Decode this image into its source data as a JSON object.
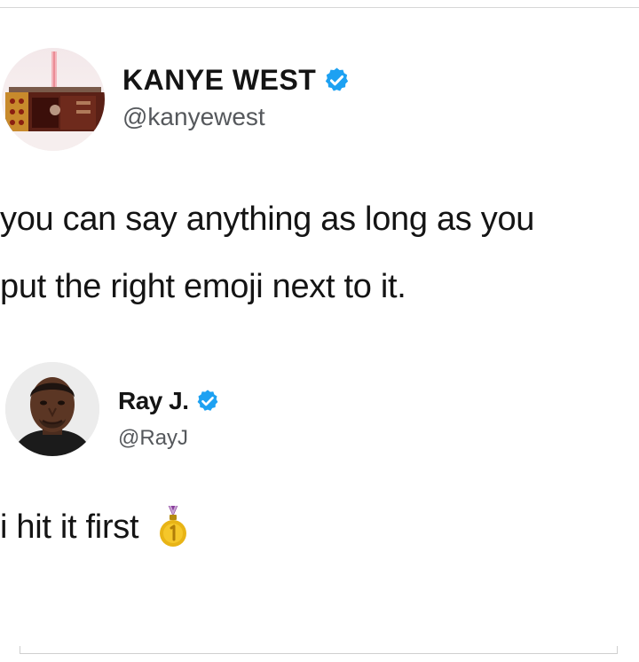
{
  "tweets": [
    {
      "display_name": "KANYE WEST",
      "handle": "@kanyewest",
      "verified": true,
      "avatar_icon": "album-art-avatar",
      "text_lines": [
        "you can say anything as long as you",
        "put the right emoji next to it."
      ]
    },
    {
      "display_name": "Ray J.",
      "handle": "@RayJ",
      "verified": true,
      "avatar_icon": "profile-photo-avatar",
      "text_lines": [
        "i hit it first"
      ],
      "emoji": "first-place-medal-icon"
    }
  ],
  "colors": {
    "verified_blue": "#1da1f2",
    "text": "#141414",
    "handle_gray": "#55585c",
    "medal_gold": "#e8b416"
  }
}
